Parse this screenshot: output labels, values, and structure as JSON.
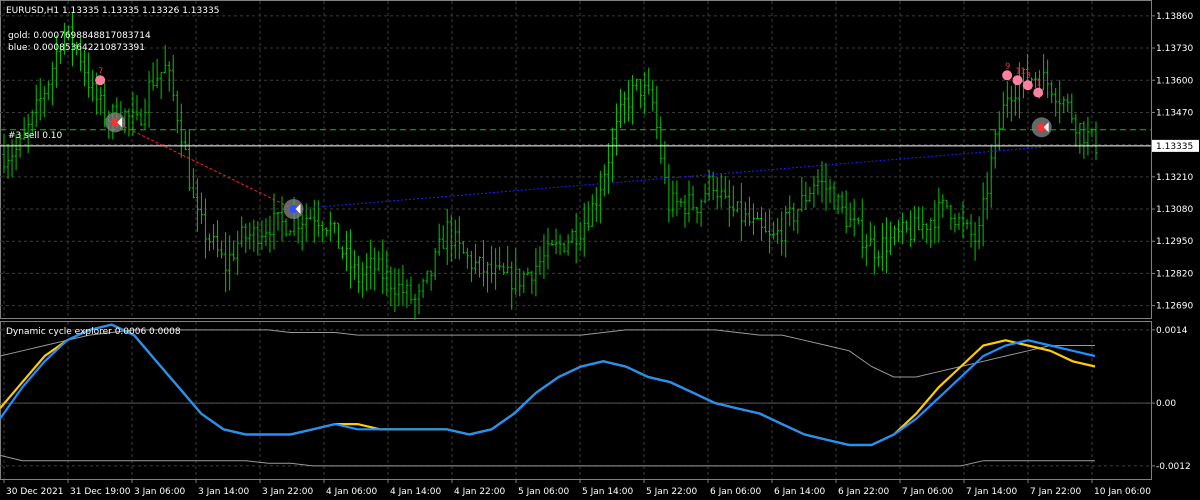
{
  "header": {
    "symbol_line": "EURUSD,H1  1.13335 1.13335 1.13326 1.13335",
    "gold_line": "gold: 0.0007698848817083714",
    "blue_line": "blue: 0.000853642210873391",
    "order_label": "#3 sell 0.10"
  },
  "colors": {
    "background": "#000000",
    "candle": "#00c800",
    "grid": "#3c3c3c",
    "price_line": "#ffffff",
    "gold": "#ffcc00",
    "blue": "#1e90ff",
    "envelope": "#9a9a9a",
    "marker": "#ff7f9f",
    "trade_red": "#ff2020",
    "trade_blue": "#2020ff",
    "order_line": "#00c800",
    "arrow_circle": "#808080"
  },
  "chart_data": [
    {
      "type": "candlestick",
      "title": "EURUSD,H1",
      "ylim": [
        1.1264,
        1.1392
      ],
      "y_ticks": [
        "1.13860",
        "1.13730",
        "1.13600",
        "1.13470",
        "1.13340",
        "1.13210",
        "1.13080",
        "1.12950",
        "1.12820",
        "1.12690"
      ],
      "current_price": "1.13335",
      "order_price": 1.134,
      "x_ticks": [
        "30 Dec 2021",
        "31 Dec 19:00",
        "3 Jan 06:00",
        "3 Jan 14:00",
        "3 Jan 22:00",
        "4 Jan 06:00",
        "4 Jan 14:00",
        "4 Jan 22:00",
        "5 Jan 06:00",
        "5 Jan 14:00",
        "5 Jan 22:00",
        "6 Jan 06:00",
        "6 Jan 14:00",
        "6 Jan 22:00",
        "7 Jan 06:00",
        "7 Jan 14:00",
        "7 Jan 22:00",
        "10 Jan 06:00"
      ],
      "close_path": [
        1.133,
        1.1332,
        1.1345,
        1.136,
        1.138,
        1.1373,
        1.1355,
        1.1345,
        1.1347,
        1.1342,
        1.136,
        1.1365,
        1.134,
        1.1305,
        1.1295,
        1.1285,
        1.1296,
        1.1298,
        1.1302,
        1.1302,
        1.1304,
        1.1306,
        1.1302,
        1.129,
        1.128,
        1.1285,
        1.128,
        1.1275,
        1.127,
        1.1283,
        1.13,
        1.129,
        1.1285,
        1.1282,
        1.128,
        1.128,
        1.1285,
        1.129,
        1.1295,
        1.13,
        1.131,
        1.133,
        1.135,
        1.1358,
        1.135,
        1.131,
        1.131,
        1.131,
        1.132,
        1.1308,
        1.1305,
        1.13,
        1.1295,
        1.1302,
        1.131,
        1.132,
        1.1315,
        1.1305,
        1.1298,
        1.1292,
        1.1295,
        1.1298,
        1.13,
        1.1305,
        1.131,
        1.13,
        1.1295,
        1.133,
        1.1355,
        1.136,
        1.1362,
        1.1358,
        1.135,
        1.134,
        1.1334
      ],
      "events": [
        {
          "type": "marker",
          "x": 0.087,
          "y": 1.136,
          "label": "7"
        },
        {
          "type": "entry_sell",
          "x": 0.1,
          "y": 1.1343
        },
        {
          "type": "exit_buy",
          "x": 0.255,
          "y": 1.1308
        },
        {
          "type": "marker",
          "x": 0.875,
          "y": 1.1362,
          "label": "9"
        },
        {
          "type": "marker",
          "x": 0.884,
          "y": 1.136,
          "label": "11"
        },
        {
          "type": "marker",
          "x": 0.893,
          "y": 1.1358,
          "label": "3"
        },
        {
          "type": "marker",
          "x": 0.902,
          "y": 1.1355,
          "label": "1"
        },
        {
          "type": "entry_sell",
          "x": 0.905,
          "y": 1.1341
        }
      ]
    },
    {
      "type": "line",
      "title": "Dynamic cycle explorer 0.0006 0.0008",
      "ylim": [
        -0.00145,
        0.00155
      ],
      "y_ticks": [
        "0.0014",
        "0.00",
        "-0.0012"
      ],
      "series": [
        {
          "name": "gold",
          "values": [
            -0.0001,
            0.0004,
            0.0009,
            0.0012,
            0.0014,
            0.0015,
            0.0013,
            0.0008,
            0.0003,
            -0.0002,
            -0.0005,
            -0.0006,
            -0.0006,
            -0.0006,
            -0.0005,
            -0.0004,
            -0.0004,
            -0.0005,
            -0.0005,
            -0.0005,
            -0.0005,
            -0.0006,
            -0.0005,
            -0.0002,
            0.0002,
            0.0005,
            0.0007,
            0.0008,
            0.0007,
            0.0005,
            0.0004,
            0.0002,
            0.0,
            -0.0001,
            -0.0002,
            -0.0004,
            -0.0006,
            -0.0007,
            -0.0008,
            -0.0008,
            -0.0006,
            -0.0002,
            0.0003,
            0.0007,
            0.0011,
            0.0012,
            0.0011,
            0.001,
            0.0008,
            0.0007
          ]
        },
        {
          "name": "blue",
          "values": [
            -0.0003,
            0.0003,
            0.0008,
            0.0012,
            0.0014,
            0.0015,
            0.0013,
            0.0008,
            0.0003,
            -0.0002,
            -0.0005,
            -0.0006,
            -0.0006,
            -0.0006,
            -0.0005,
            -0.0004,
            -0.0005,
            -0.0005,
            -0.0005,
            -0.0005,
            -0.0005,
            -0.0006,
            -0.0005,
            -0.0002,
            0.0002,
            0.0005,
            0.0007,
            0.0008,
            0.0007,
            0.0005,
            0.0004,
            0.0002,
            0.0,
            -0.0001,
            -0.0002,
            -0.0004,
            -0.0006,
            -0.0007,
            -0.0008,
            -0.0008,
            -0.0006,
            -0.0003,
            0.0001,
            0.0005,
            0.0009,
            0.0011,
            0.0012,
            0.0011,
            0.001,
            0.0009
          ]
        },
        {
          "name": "upper",
          "values": [
            0.0009,
            0.001,
            0.0011,
            0.0012,
            0.0013,
            0.00135,
            0.0014,
            0.0014,
            0.0014,
            0.0014,
            0.0014,
            0.0014,
            0.0014,
            0.00135,
            0.00135,
            0.00135,
            0.0013,
            0.0013,
            0.0013,
            0.0013,
            0.0013,
            0.0013,
            0.0013,
            0.0013,
            0.0013,
            0.0013,
            0.0013,
            0.00135,
            0.0014,
            0.0014,
            0.0014,
            0.0014,
            0.0014,
            0.00135,
            0.0013,
            0.0013,
            0.0012,
            0.0011,
            0.001,
            0.0007,
            0.0005,
            0.0005,
            0.0006,
            0.0007,
            0.0008,
            0.0009,
            0.001,
            0.0011,
            0.0011,
            0.0011
          ]
        },
        {
          "name": "lower",
          "values": [
            -0.001,
            -0.0011,
            -0.0011,
            -0.0011,
            -0.0011,
            -0.0011,
            -0.0011,
            -0.0011,
            -0.0011,
            -0.0011,
            -0.0011,
            -0.0011,
            -0.00115,
            -0.00115,
            -0.0012,
            -0.0012,
            -0.0012,
            -0.0012,
            -0.0012,
            -0.0012,
            -0.0012,
            -0.0012,
            -0.0012,
            -0.0012,
            -0.0012,
            -0.0012,
            -0.0012,
            -0.0012,
            -0.0012,
            -0.0012,
            -0.0012,
            -0.0012,
            -0.0012,
            -0.0012,
            -0.0012,
            -0.0012,
            -0.0012,
            -0.0012,
            -0.0012,
            -0.0012,
            -0.0012,
            -0.0012,
            -0.0012,
            -0.0012,
            -0.0011,
            -0.0011,
            -0.0011,
            -0.0011,
            -0.0011,
            -0.0011
          ]
        }
      ]
    }
  ]
}
